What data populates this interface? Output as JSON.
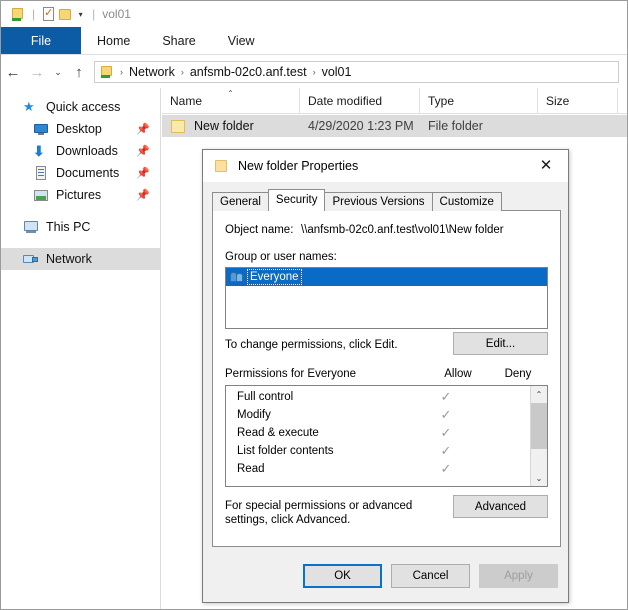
{
  "window": {
    "title": "vol01",
    "quick_access_toolbar": [
      {
        "icon": "folder-pin-icon",
        "name": "pin-to-quick-access"
      },
      {
        "icon": "properties-icon",
        "name": "properties"
      },
      {
        "icon": "new-folder-icon",
        "name": "new-folder"
      },
      {
        "icon": "chevron-down-icon",
        "name": "customize-qat"
      }
    ]
  },
  "ribbon": {
    "tabs": [
      {
        "label": "File",
        "active": true
      },
      {
        "label": "Home",
        "active": false
      },
      {
        "label": "Share",
        "active": false
      },
      {
        "label": "View",
        "active": false
      }
    ]
  },
  "navigation": {
    "back_icon": "←",
    "forward_icon": "→",
    "recent_icon": "⌄",
    "up_icon": "↑",
    "breadcrumbs": [
      "Network",
      "anfsmb-02c0.anf.test",
      "vol01"
    ],
    "separator": "›"
  },
  "sidebar": {
    "items": [
      {
        "label": "Quick access",
        "icon": "star-icon",
        "indent": false,
        "pinned": false,
        "selected": false
      },
      {
        "label": "Desktop",
        "icon": "desktop-icon",
        "indent": true,
        "pinned": true,
        "selected": false
      },
      {
        "label": "Downloads",
        "icon": "download-icon",
        "indent": true,
        "pinned": true,
        "selected": false
      },
      {
        "label": "Documents",
        "icon": "documents-icon",
        "indent": true,
        "pinned": true,
        "selected": false
      },
      {
        "label": "Pictures",
        "icon": "pictures-icon",
        "indent": true,
        "pinned": true,
        "selected": false
      },
      {
        "label": "This PC",
        "icon": "this-pc-icon",
        "indent": false,
        "pinned": false,
        "selected": false
      },
      {
        "label": "Network",
        "icon": "network-icon",
        "indent": false,
        "pinned": false,
        "selected": true
      }
    ],
    "pin_glyph": "📌"
  },
  "file_list": {
    "columns": [
      {
        "label": "Name",
        "sorted": true,
        "sort_glyph": "⌃"
      },
      {
        "label": "Date modified",
        "sorted": false
      },
      {
        "label": "Type",
        "sorted": false
      },
      {
        "label": "Size",
        "sorted": false
      }
    ],
    "rows": [
      {
        "name": "New folder",
        "date_modified": "4/29/2020 1:23 PM",
        "type": "File folder",
        "size": "",
        "icon": "folder-icon",
        "selected": true
      }
    ]
  },
  "dialog": {
    "title": "New folder Properties",
    "title_icon": "folder-icon",
    "close_glyph": "✕",
    "tabs": [
      {
        "label": "General",
        "active": false
      },
      {
        "label": "Security",
        "active": true
      },
      {
        "label": "Previous Versions",
        "active": false
      },
      {
        "label": "Customize",
        "active": false
      }
    ],
    "security": {
      "object_name_label": "Object name:",
      "object_name_value": "\\\\anfsmb-02c0.anf.test\\vol01\\New folder",
      "group_or_user_names_label": "Group or user names:",
      "users": [
        {
          "name": "Everyone",
          "icon": "users-icon",
          "selected": true
        }
      ],
      "change_permissions_text": "To change permissions, click Edit.",
      "edit_button": "Edit...",
      "permissions_for_label": "Permissions for Everyone",
      "allow_column": "Allow",
      "deny_column": "Deny",
      "check_glyph": "✓",
      "permissions": [
        {
          "name": "Full control",
          "allow": true,
          "deny": false
        },
        {
          "name": "Modify",
          "allow": true,
          "deny": false
        },
        {
          "name": "Read & execute",
          "allow": true,
          "deny": false
        },
        {
          "name": "List folder contents",
          "allow": true,
          "deny": false
        },
        {
          "name": "Read",
          "allow": true,
          "deny": false
        }
      ],
      "scroll_up_glyph": "⌃",
      "scroll_down_glyph": "⌄",
      "special_permissions_text": "For special permissions or advanced settings, click Advanced.",
      "advanced_button": "Advanced"
    },
    "footer": {
      "ok": "OK",
      "cancel": "Cancel",
      "apply": "Apply",
      "apply_disabled": true
    }
  },
  "colors": {
    "accent": "#0c5ba5",
    "selection": "#0a6bc6",
    "row_selection": "#dcdcdc",
    "focus_border": "#0a72c8"
  }
}
